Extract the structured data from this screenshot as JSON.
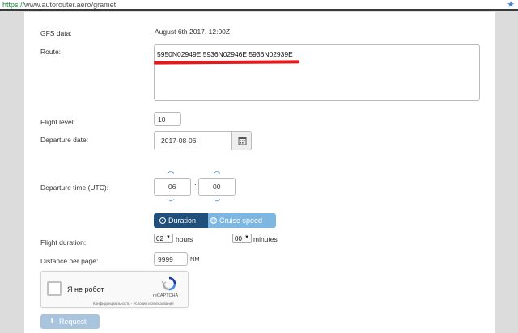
{
  "browser": {
    "url_scheme": "https://",
    "url_rest": "www.autorouter.aero/gramet",
    "star_icon": "star-icon"
  },
  "form": {
    "gfs_label": "GFS data:",
    "gfs_value": "August 6th 2017, 12:00Z",
    "route_label": "Route:",
    "route_value": "5950N02949E 5936N02946E 5936N02939E",
    "flight_level_label": "Flight level:",
    "flight_level_value": "10",
    "departure_date_label": "Departure date:",
    "departure_date_value": "2017-08-06",
    "departure_time_label": "Departure time (UTC):",
    "hour_value": "06",
    "colon": ":",
    "minute_value": "00",
    "toggle": {
      "duration_label": "Duration",
      "cruise_label": "Cruise speed",
      "selected": "Duration"
    },
    "flight_duration_label": "Flight duration:",
    "hours_value": "02",
    "hours_unit": "hours",
    "minutes_value": "00",
    "minutes_unit": "minutes",
    "distance_label": "Distance per page:",
    "distance_value": "9999",
    "distance_unit": "NM",
    "captcha": {
      "label": "Я не робот",
      "brand": "reCAPTCHA",
      "links": "Конфиденциальность - Условия использования"
    },
    "request_button": "Request"
  },
  "colors": {
    "accent": "#1f4f7a",
    "accent_light": "#7db6e0",
    "chevron": "#2a7ac7",
    "annotation": "#e3191c",
    "button_disabled": "#a9c4dd"
  }
}
